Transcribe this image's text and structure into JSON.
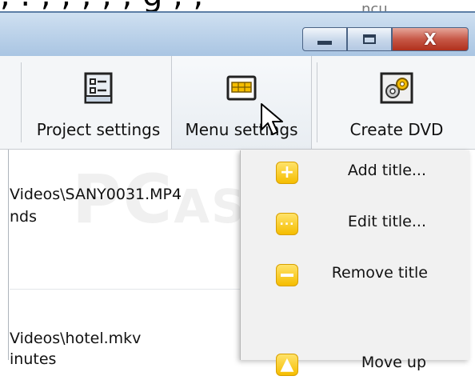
{
  "toolbar": {
    "project_settings_label": "Project settings",
    "menu_settings_label": "Menu settings",
    "create_dvd_label": "Create DVD"
  },
  "window": {
    "close_glyph": "X"
  },
  "content": {
    "row1_line1": "Videos\\SANY0031.MP4",
    "row1_line2": "nds",
    "row2_line1": "Videos\\hotel.mkv",
    "row2_line2": "inutes"
  },
  "context_menu": {
    "items": [
      {
        "label": "Add title...",
        "icon": "plus-icon"
      },
      {
        "label": "Edit title...",
        "icon": "ellipsis-icon"
      },
      {
        "label": "Remove title",
        "icon": "minus-icon"
      },
      {
        "label": "Move up",
        "icon": "arrow-up-icon"
      }
    ]
  },
  "watermark": {
    "text": "PC",
    "subtext": "ASTUCES"
  },
  "colors": {
    "menu_icon": "#f5bd00",
    "close_button": "#c75847",
    "titlebar": "#bdd3ea"
  }
}
